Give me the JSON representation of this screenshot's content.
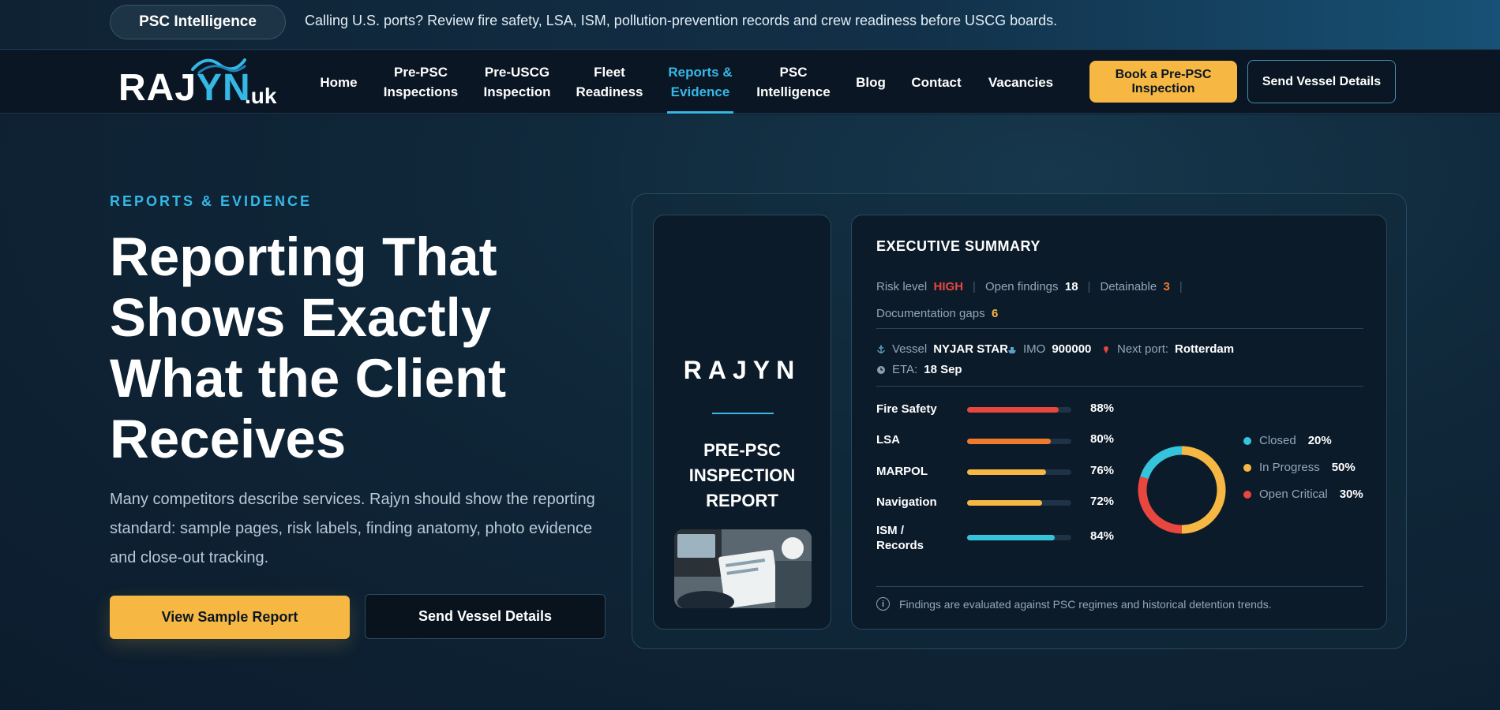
{
  "topbar": {
    "pill_label": "PSC Intelligence",
    "message": "Calling U.S. ports? Review fire safety, LSA, ISM, pollution-prevention records and crew readiness before USCG boards."
  },
  "logo": {
    "main": "RAJ",
    "accent": "YN",
    "tld": ".uk"
  },
  "nav": {
    "items": [
      {
        "label": "Home"
      },
      {
        "label": "Pre-PSC Inspections"
      },
      {
        "label": "Pre-USCG Inspection"
      },
      {
        "label": "Fleet Readiness"
      },
      {
        "label": "Reports & Evidence"
      },
      {
        "label": "PSC Intelligence"
      },
      {
        "label": "Blog"
      },
      {
        "label": "Contact"
      },
      {
        "label": "Vacancies"
      }
    ],
    "active": "Reports & Evidence",
    "book_label": "Book a Pre-PSC Inspection",
    "send_label": "Send Vessel Details"
  },
  "hero": {
    "eyebrow": "REPORTS & EVIDENCE",
    "headline": "Reporting That Shows Exactly What the Client Receives",
    "lead": "Many competitors describe services. Rajyn should show the reporting standard: sample pages, risk labels, finding anatomy, photo evidence and close-out tracking.",
    "primary_cta": "View Sample Report",
    "secondary_cta": "Send Vessel Details"
  },
  "report": {
    "cover_brand": "RAJYN",
    "cover_title": "PRE-PSC INSPECTION REPORT",
    "summary_title": "EXECUTIVE SUMMARY",
    "risk_label": "Risk level",
    "risk_value": "HIGH",
    "open_label": "Open findings",
    "open_value": "18",
    "detain_label": "Detainable",
    "detain_value": "3",
    "gaps_label": "Documentation gaps",
    "gaps_value": "6",
    "vessel_label": "Vessel",
    "vessel_value": "NYJAR STAR",
    "imo_label": "IMO",
    "imo_value": "900000",
    "port_label": "Next port:",
    "port_value": "Rotterdam",
    "eta_label": "ETA:",
    "eta_value": "18 Sep",
    "note": "Findings are evaluated against PSC regimes and historical detention trends."
  },
  "colors": {
    "accent": "#35b8e6",
    "cta": "#f6b843",
    "critical": "#e8473f",
    "orange": "#f07a2b"
  },
  "chart_data": [
    {
      "type": "bar",
      "categories": [
        "Fire Safety",
        "LSA",
        "MARPOL",
        "Navigation",
        "ISM / Records"
      ],
      "values": [
        88,
        80,
        76,
        72,
        84
      ],
      "value_labels": [
        "88%",
        "80%",
        "76%",
        "72%",
        "84%"
      ],
      "colors": [
        "#e8473f",
        "#f07a2b",
        "#f6b843",
        "#f6b843",
        "#35c4dc"
      ],
      "ylim": [
        0,
        100
      ]
    },
    {
      "type": "pie",
      "categories": [
        "Closed",
        "In Progress",
        "Open Critical"
      ],
      "values": [
        20,
        50,
        30
      ],
      "value_labels": [
        "20%",
        "50%",
        "30%"
      ],
      "colors": [
        "#35c4dc",
        "#f6b843",
        "#e8473f"
      ]
    }
  ]
}
